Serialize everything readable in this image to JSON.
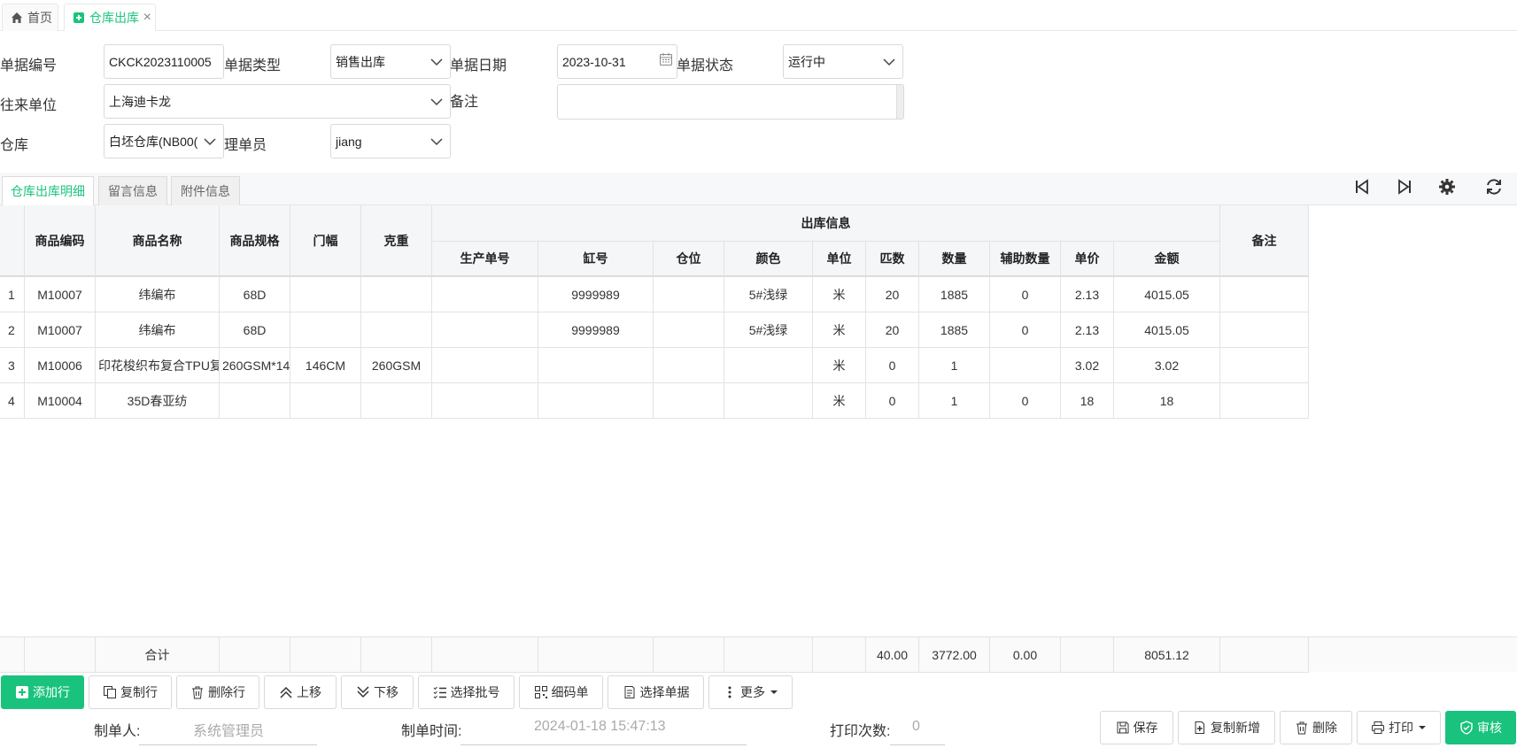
{
  "tabs": {
    "home": "首页",
    "active": "仓库出库"
  },
  "form": {
    "doc_no_label": "单据编号",
    "doc_no": "CKCK2023110005",
    "doc_type_label": "单据类型",
    "doc_type": "销售出库",
    "doc_date_label": "单据日期",
    "doc_date": "2023-10-31",
    "doc_status_label": "单据状态",
    "doc_status": "运行中",
    "partner_label": "往来单位",
    "partner": "上海迪卡龙",
    "remark_label": "备注",
    "remark": "",
    "warehouse_label": "仓库",
    "warehouse": "白坯仓库(NB00(",
    "handler_label": "理单员",
    "handler": "jiang"
  },
  "detail_tabs": [
    "仓库出库明细",
    "留言信息",
    "附件信息"
  ],
  "table": {
    "group_header": "出库信息",
    "headers": {
      "code": "商品编码",
      "name": "商品名称",
      "spec": "商品规格",
      "width": "门幅",
      "weight": "克重",
      "prod_no": "生产单号",
      "vat_no": "缸号",
      "location": "仓位",
      "color": "颜色",
      "unit": "单位",
      "pieces": "匹数",
      "qty": "数量",
      "aux_qty": "辅助数量",
      "price": "单价",
      "amount": "金额",
      "remark": "备注"
    },
    "rows": [
      {
        "idx": "1",
        "code": "M10007",
        "name": "纬编布",
        "spec": "68D",
        "width": "",
        "weight": "",
        "prod_no": "",
        "vat_no": "9999989",
        "location": "",
        "color": "5#浅绿",
        "unit": "米",
        "pieces": "20",
        "qty": "1885",
        "aux_qty": "0",
        "price": "2.13",
        "amount": "4015.05",
        "remark": ""
      },
      {
        "idx": "2",
        "code": "M10007",
        "name": "纬编布",
        "spec": "68D",
        "width": "",
        "weight": "",
        "prod_no": "",
        "vat_no": "9999989",
        "location": "",
        "color": "5#浅绿",
        "unit": "米",
        "pieces": "20",
        "qty": "1885",
        "aux_qty": "0",
        "price": "2.13",
        "amount": "4015.05",
        "remark": ""
      },
      {
        "idx": "3",
        "code": "M10006",
        "name": "印花梭织布复合TPU复",
        "spec": "260GSM*14",
        "width": "146CM",
        "weight": "260GSM",
        "prod_no": "",
        "vat_no": "",
        "location": "",
        "color": "",
        "unit": "米",
        "pieces": "0",
        "qty": "1",
        "aux_qty": "",
        "price": "3.02",
        "amount": "3.02",
        "remark": ""
      },
      {
        "idx": "4",
        "code": "M10004",
        "name": "35D春亚纺",
        "spec": "",
        "width": "",
        "weight": "",
        "prod_no": "",
        "vat_no": "",
        "location": "",
        "color": "",
        "unit": "米",
        "pieces": "0",
        "qty": "1",
        "aux_qty": "0",
        "price": "18",
        "amount": "18",
        "remark": ""
      }
    ],
    "summary": {
      "label": "合计",
      "pieces": "40.00",
      "qty": "3772.00",
      "aux_qty": "0.00",
      "amount": "8051.12"
    }
  },
  "toolbar": {
    "add_row": "添加行",
    "copy_row": "复制行",
    "delete_row": "删除行",
    "move_up": "上移",
    "move_down": "下移",
    "select_batch": "选择批号",
    "barcode": "细码单",
    "select_doc": "选择单据",
    "more": "更多"
  },
  "footer": {
    "creator_label": "制单人:",
    "creator": "系统管理员",
    "created_time_label": "制单时间:",
    "created_time": "2024-01-18 15:47:13",
    "print_count_label": "打印次数:",
    "print_count": "0",
    "save": "保存",
    "copy_new": "复制新增",
    "delete": "删除",
    "print": "打印",
    "audit": "审核"
  },
  "colors": {
    "accent": "#19c37d"
  }
}
